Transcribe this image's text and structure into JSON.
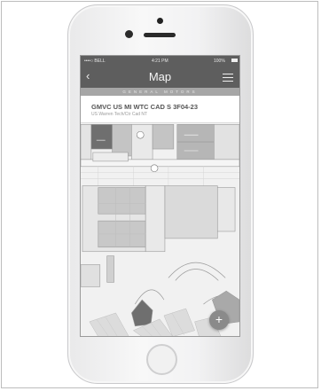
{
  "status": {
    "carrier": "••••○ BELL",
    "time": "4:21 PM",
    "battery": "100%"
  },
  "nav": {
    "back": "‹",
    "title": "Map"
  },
  "brand": {
    "name": "GENERAL MOTORS"
  },
  "room": {
    "code": "GMVC US MI WTC CAD S 3F04-23",
    "subtitle": "US Warren Tech/Ctr Cad NT"
  },
  "fab": {
    "label": "+"
  },
  "icons": [
    "wifi-icon",
    "battery-icon",
    "back-chevron-icon",
    "menu-icon",
    "restroom-icon",
    "plus-icon"
  ],
  "colors": {
    "bars": "#5e5e5e",
    "brand_bar": "#a6a6a6",
    "highlight_room": "#6f6f6f",
    "rooms": "#c9c9c9",
    "fab": "#8a8a8a"
  }
}
